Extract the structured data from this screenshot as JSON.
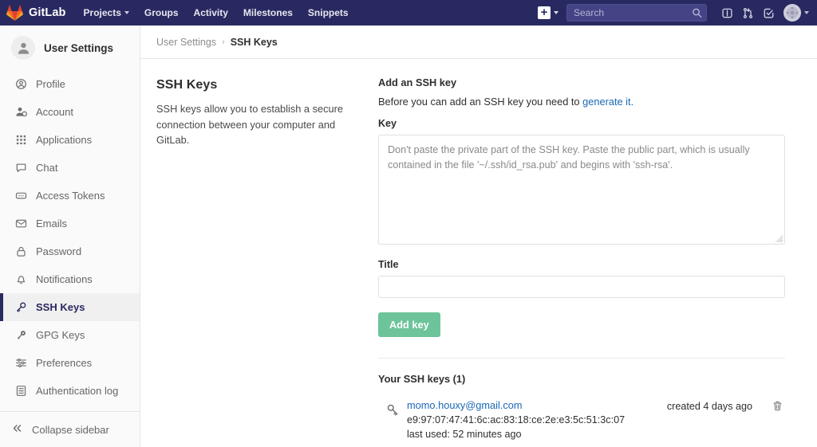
{
  "navbar": {
    "brand": "GitLab",
    "brand_logo_icon": "gitlab-logo-icon",
    "links": [
      {
        "label": "Projects",
        "has_caret": true
      },
      {
        "label": "Groups",
        "has_caret": false
      },
      {
        "label": "Activity",
        "has_caret": false
      },
      {
        "label": "Milestones",
        "has_caret": false
      },
      {
        "label": "Snippets",
        "has_caret": false
      }
    ],
    "plus_label": "+",
    "search_placeholder": "Search",
    "search_value": "",
    "icons": [
      "issues-icon",
      "merge-requests-icon",
      "todos-icon"
    ],
    "avatar_icon": "user-avatar"
  },
  "sidebar": {
    "title": "User Settings",
    "avatar_icon": "user-avatar-icon",
    "items": [
      {
        "label": "Profile",
        "icon": "profile-icon",
        "active": false
      },
      {
        "label": "Account",
        "icon": "account-icon",
        "active": false
      },
      {
        "label": "Applications",
        "icon": "applications-icon",
        "active": false
      },
      {
        "label": "Chat",
        "icon": "chat-icon",
        "active": false
      },
      {
        "label": "Access Tokens",
        "icon": "access-tokens-icon",
        "active": false
      },
      {
        "label": "Emails",
        "icon": "emails-icon",
        "active": false
      },
      {
        "label": "Password",
        "icon": "lock-icon",
        "active": false
      },
      {
        "label": "Notifications",
        "icon": "bell-icon",
        "active": false
      },
      {
        "label": "SSH Keys",
        "icon": "key-icon",
        "active": true
      },
      {
        "label": "GPG Keys",
        "icon": "key-icon",
        "active": false
      },
      {
        "label": "Preferences",
        "icon": "sliders-icon",
        "active": false
      },
      {
        "label": "Authentication log",
        "icon": "log-icon",
        "active": false
      }
    ],
    "collapse_label": "Collapse sidebar",
    "collapse_icon": "chevron-double-left-icon"
  },
  "breadcrumb": {
    "parent": "User Settings",
    "separator": "›",
    "current": "SSH Keys"
  },
  "page": {
    "section_title": "SSH Keys",
    "section_description": "SSH keys allow you to establish a secure connection between your computer and GitLab."
  },
  "form": {
    "title": "Add an SSH key",
    "subtitle_prefix": "Before you can add an SSH key you need to ",
    "subtitle_link": "generate it.",
    "key_label": "Key",
    "key_value": "",
    "key_placeholder": "Don't paste the private part of the SSH key. Paste the public part, which is usually contained in the file '~/.ssh/id_rsa.pub' and begins with 'ssh-rsa'.",
    "title_label": "Title",
    "title_value": "",
    "title_placeholder": "",
    "submit_label": "Add key"
  },
  "keys_section": {
    "heading": "Your SSH keys (1)",
    "rows": [
      {
        "name": "momo.houxy@gmail.com",
        "fingerprint": "e9:97:07:47:41:6c:ac:83:18:ce:2e:e3:5c:51:3c:07",
        "last_used": "last used: 52 minutes ago",
        "created": "created 4 days ago",
        "key_icon": "key-icon",
        "delete_icon": "trash-icon"
      }
    ]
  },
  "colors": {
    "navbar_bg": "#292961",
    "accent_purple": "#292961",
    "link_blue": "#1b69b6",
    "button_green": "#6dc49a",
    "sidebar_bg": "#fafafa"
  }
}
